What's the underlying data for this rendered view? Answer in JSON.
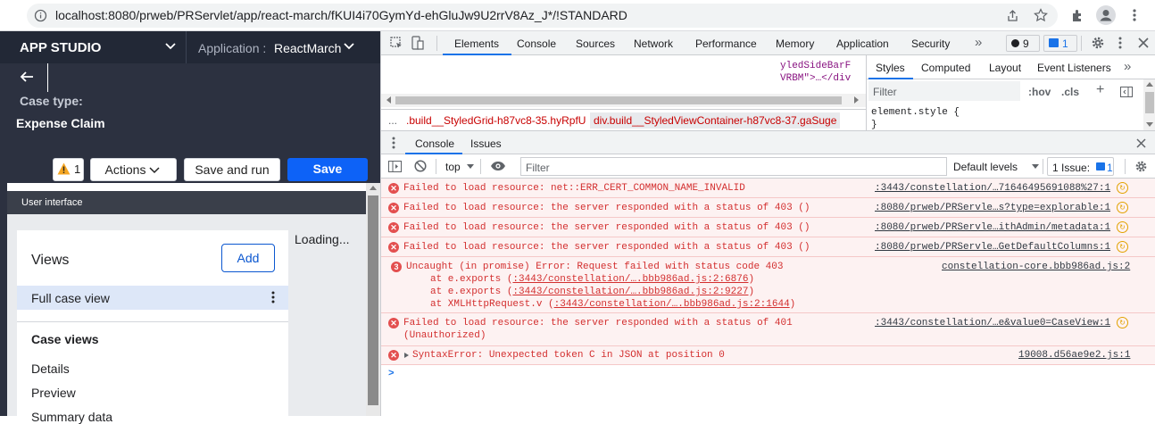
{
  "browser": {
    "url": "localhost:8080/prweb/PRServlet/app/react-march/fKUI4i70GymYd-ehGluJw9U2rrV8Az_J*/!STANDARD"
  },
  "app": {
    "studio_label": "APP STUDIO",
    "application_prefix": "Application :",
    "application_name": "ReactMarch",
    "case_type_label": "Case type:",
    "case_type_name": "Expense Claim",
    "warning_count": "1",
    "actions_label": "Actions",
    "save_run_label": "Save and run",
    "save_label": "Save",
    "ui_header": "User interface",
    "views_title": "Views",
    "add_label": "Add",
    "full_case_view": "Full case view",
    "case_views_title": "Case views",
    "case_views": [
      "Details",
      "Preview",
      "Summary data"
    ],
    "loading": "Loading..."
  },
  "devtools": {
    "tabs": [
      "Elements",
      "Console",
      "Sources",
      "Network",
      "Performance",
      "Memory",
      "Application",
      "Security"
    ],
    "more": "»",
    "error_count": "9",
    "issue_count": "1",
    "elements_snip1": "yledSideBarF",
    "elements_snip2": "VRBM\">…</div",
    "breadcrumb_1": ".build__StyledGrid-h87vc8-35.hyRpfU",
    "breadcrumb_2": "div.build__StyledViewContainer-h87vc8-37.gaSuge",
    "styles_tabs": [
      "Styles",
      "Computed",
      "Layout",
      "Event Listeners"
    ],
    "styles_filter": "Filter",
    "hov": ":hov",
    "cls": ".cls",
    "element_style": "element.style {",
    "element_style_close": "}",
    "drawer_tabs": [
      "Console",
      "Issues"
    ],
    "context": "top",
    "filter_placeholder": "Filter",
    "default_levels": "Default levels",
    "issues_btn": "1 Issue:",
    "issues_btn_count": "1",
    "messages": [
      {
        "text": "Failed to load resource: net::ERR_CERT_COMMON_NAME_INVALID",
        "source": ":3443/constellation/…71646495691088%27:1"
      },
      {
        "text": "Failed to load resource: the server responded with a status of 403 ()",
        "source": ":8080/prweb/PRServle…s?type=explorable:1"
      },
      {
        "text": "Failed to load resource: the server responded with a status of 403 ()",
        "source": ":8080/prweb/PRServle…ithAdmin/metadata:1"
      },
      {
        "text": "Failed to load resource: the server responded with a status of 403 ()",
        "source": ":8080/prweb/PRServle…GetDefaultColumns:1"
      }
    ],
    "uncaught": {
      "count": "3",
      "text": "Uncaught (in promise) Error: Request failed with status code 403",
      "source": "constellation-core.bbb986ad.js:2",
      "stack": [
        {
          "pre": "at e.exports (",
          "link": ":3443/constellation/….bbb986ad.js:2:6876",
          "post": ")"
        },
        {
          "pre": "at e.exports (",
          "link": ":3443/constellation/….bbb986ad.js:2:9227",
          "post": ")"
        },
        {
          "pre": "at XMLHttpRequest.v (",
          "link": ":3443/constellation/….bbb986ad.js:2:1644",
          "post": ")"
        }
      ]
    },
    "msg401_line1": "Failed to load resource: the server responded with a status of 401",
    "msg401_line2": "(Unauthorized)",
    "msg401_source": ":3443/constellation/…e&value0=CaseView:1",
    "syntax_text": "SyntaxError: Unexpected token C in JSON at position 0",
    "syntax_source": "19008.d56ae9e2.js:1",
    "prompt": ">"
  },
  "colors": {
    "accent": "#0b57d0",
    "save_button": "#0d62f7",
    "error": "#d32f2f"
  }
}
